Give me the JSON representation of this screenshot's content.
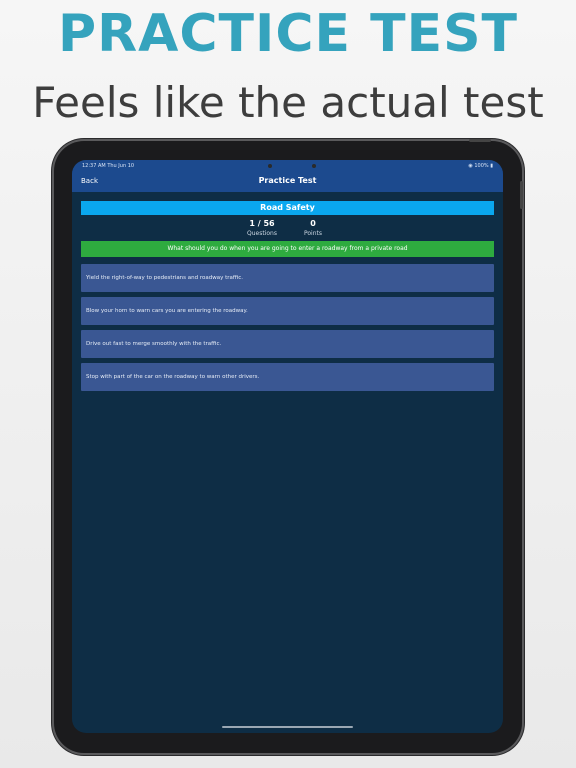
{
  "promo": {
    "headline": "PRACTICE TEST",
    "subhead": "Feels like the actual test"
  },
  "status_bar": {
    "time": "12:37 AM   Thu Jun 10",
    "battery": "100%"
  },
  "nav": {
    "back_label": "Back",
    "title": "Practice Test"
  },
  "quiz": {
    "category": "Road Safety",
    "progress": {
      "value": "1 / 56",
      "label": "Questions"
    },
    "points": {
      "value": "0",
      "label": "Points"
    },
    "question": "What should you do when you are going to enter a roadway from a private road",
    "options": [
      "Yield the right-of-way to pedestrians and roadway traffic.",
      "Blow your horn to warn cars you are entering the roadway.",
      "Drive out fast to merge smoothly with the traffic.",
      "Stop with part of the car on the roadway to warn other drivers."
    ]
  },
  "colors": {
    "headline": "#35a3bd",
    "nav_bar": "#1c4a8e",
    "category_bar": "#0aa7ef",
    "question_bar": "#2eab3f",
    "option_bg": "#3a5793",
    "screen_bg": "#0e2d45"
  }
}
